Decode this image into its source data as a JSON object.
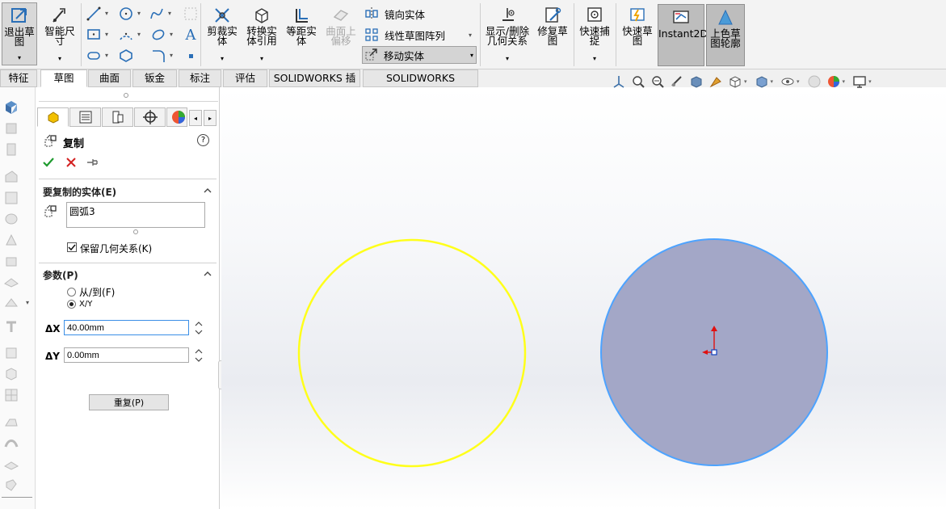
{
  "ribbon": {
    "exit_sketch": "退出草图",
    "smart_dimension": "智能尺寸",
    "trim_entities": "剪裁实体",
    "convert_entities": "转换实体引用",
    "offset_entities": "等距实体",
    "offset_on_surface": "曲面上偏移",
    "mirror_entities": "镜向实体",
    "linear_pattern": "线性草图阵列",
    "move_entities": "移动实体",
    "display_relations": "显示/删除几何关系",
    "repair_sketch": "修复草图",
    "quick_snaps": "快速捕捉",
    "rapid_sketch": "快速草图",
    "instant2d": "Instant2D",
    "shaded_contours": "上色草图轮廓"
  },
  "tabs": [
    {
      "label": "特征"
    },
    {
      "label": "草图"
    },
    {
      "label": "曲面"
    },
    {
      "label": "钣金"
    },
    {
      "label": "标注"
    },
    {
      "label": "评估"
    },
    {
      "label": "SOLIDWORKS 插件"
    },
    {
      "label": "SOLIDWORKS Inspection"
    }
  ],
  "panel": {
    "title": "复制",
    "entities_section": "要复制的实体(E)",
    "entities_list_value": "圆弧3",
    "keep_relations_label": "保留几何关系(K)",
    "keep_relations_checked": true,
    "params_section": "参数(P)",
    "radio_from_to": "从/到(F)",
    "radio_xy": "X/Y",
    "dx_label": "ΔX",
    "dx_value": "40.00mm",
    "dy_label": "ΔY",
    "dy_value": "0.00mm",
    "repeat_button": "重复(P)"
  },
  "colors": {
    "yellow_circle": "#ffff1a",
    "blue_edge": "#4da3ff",
    "fill_circle": "#a3a7c7"
  }
}
